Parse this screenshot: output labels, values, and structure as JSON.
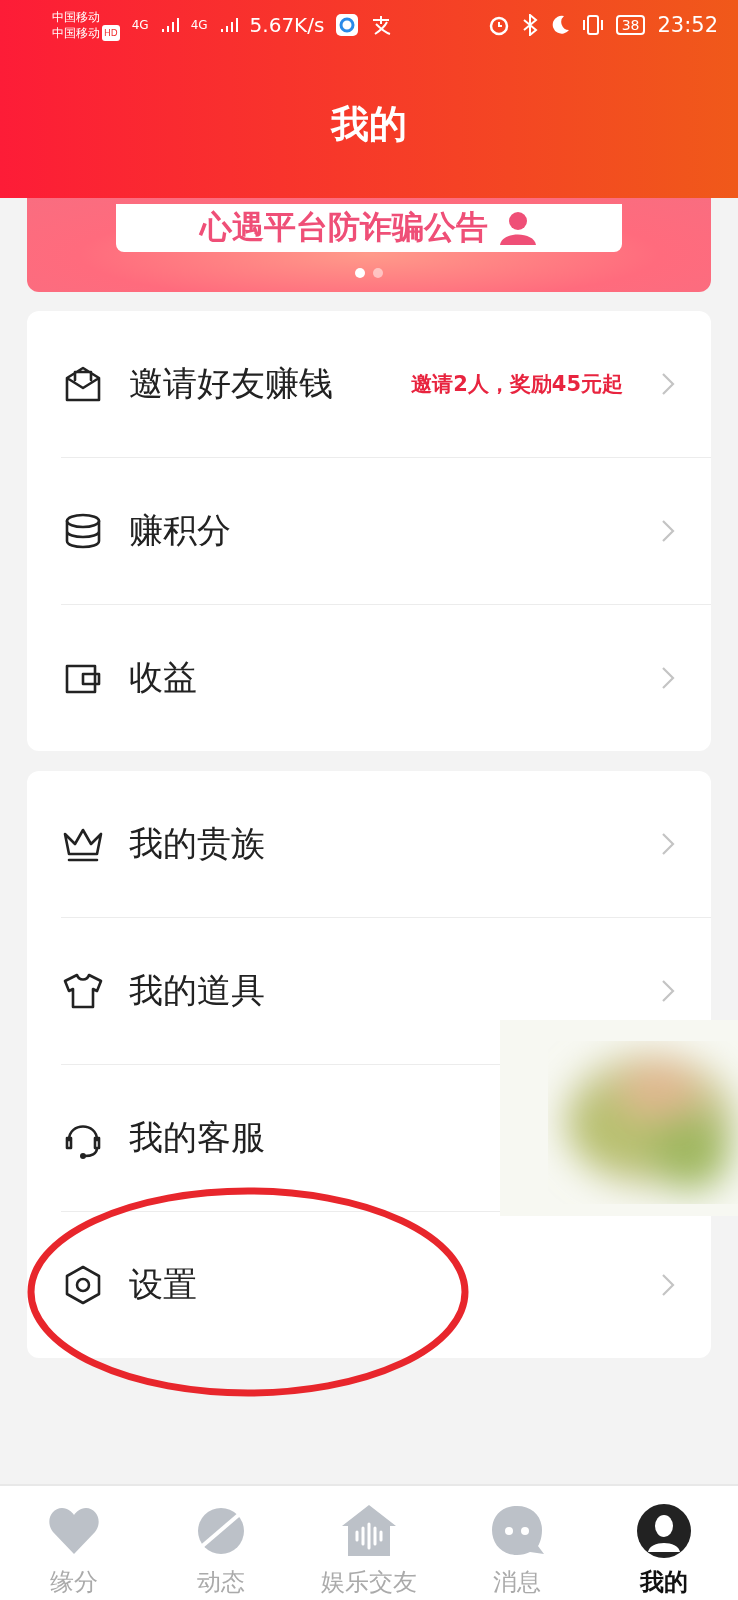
{
  "status_bar": {
    "carrier_1": "中国移动",
    "carrier_2": "中国移动",
    "hd": "HD",
    "net_1": "4G",
    "net_2": "4G",
    "speed": "5.67K/s",
    "battery": "38",
    "time": "23:52"
  },
  "header": {
    "title": "我的"
  },
  "banner": {
    "text": "心遇平台防诈骗公告",
    "dots": [
      {
        "selected": true
      },
      {
        "selected": false
      }
    ]
  },
  "groups": [
    {
      "items": [
        {
          "kind": "envelope",
          "label": "邀请好友赚钱",
          "note": "邀请2人，奖励45元起",
          "chevron": true
        },
        {
          "kind": "coins",
          "label": "赚积分",
          "chevron": true
        },
        {
          "kind": "wallet",
          "label": "收益",
          "chevron": true
        }
      ]
    },
    {
      "items": [
        {
          "kind": "crown",
          "label": "我的贵族",
          "chevron": true
        },
        {
          "kind": "shirt",
          "label": "我的道具",
          "chevron": true
        },
        {
          "kind": "headset",
          "label": "我的客服",
          "chevron": false
        },
        {
          "kind": "gear",
          "label": "设置",
          "chevron": true
        }
      ]
    }
  ],
  "tab_bar": [
    {
      "kind": "heart",
      "label": "缘分",
      "selected": false
    },
    {
      "kind": "planet",
      "label": "动态",
      "selected": false
    },
    {
      "kind": "house",
      "label": "娱乐交友",
      "selected": false
    },
    {
      "kind": "chat",
      "label": "消息",
      "selected": false
    },
    {
      "kind": "avatar",
      "label": "我的",
      "selected": true
    }
  ]
}
